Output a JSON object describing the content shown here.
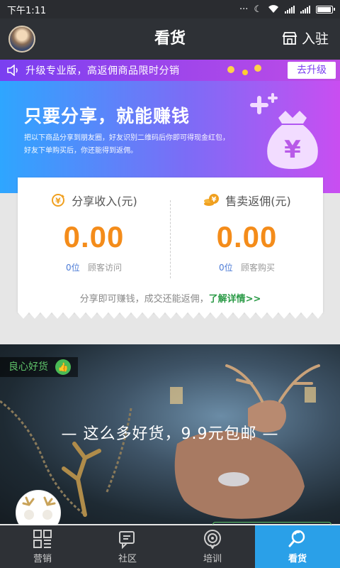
{
  "status_bar": {
    "time": "下午1:11"
  },
  "header": {
    "title": "看货",
    "join_label": "入驻"
  },
  "banner": {
    "text": "升级专业版，高返佣商品限时分销",
    "button": "去升级"
  },
  "hero": {
    "title": "只要分享，就能赚钱",
    "desc_line1": "把以下商品分享到朋友圈，好友识别二维码后你即可得现金红包，",
    "desc_line2": "好友下单购买后，你还能得到返佣。",
    "bag_symbol": "¥"
  },
  "stats": {
    "share_income": {
      "label": "分享收入(元)",
      "value": "0.00",
      "count": "0位",
      "count_label": "顾客访问"
    },
    "sales_rebate": {
      "label": "售卖返佣(元)",
      "value": "0.00",
      "count": "0位",
      "count_label": "顾客购买"
    },
    "note": "分享即可赚钱，成交还能返佣，",
    "link": "了解详情>>"
  },
  "promo": {
    "tag": "良心好货",
    "text": "— 这么多好货，9.9元包邮 —"
  },
  "tabs": [
    {
      "label": "营销",
      "icon": "grid-icon",
      "active": false
    },
    {
      "label": "社区",
      "icon": "community-icon",
      "active": false
    },
    {
      "label": "培训",
      "icon": "training-icon",
      "active": false
    },
    {
      "label": "看货",
      "icon": "search-goods-icon",
      "active": true
    }
  ],
  "colors": {
    "accent_orange": "#f48c1a",
    "tab_active": "#2aa0e8",
    "banner_purple": "#7a3ff0",
    "link_green": "#2a9a46"
  }
}
